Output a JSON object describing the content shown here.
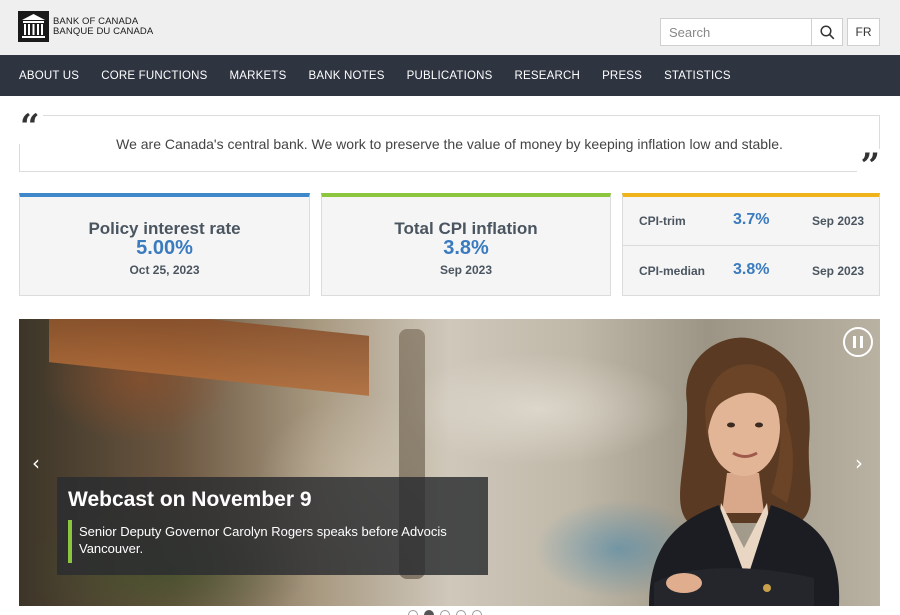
{
  "header": {
    "logo_line1": "BANK OF CANADA",
    "logo_line2": "BANQUE DU CANADA",
    "search_placeholder": "Search",
    "lang_label": "FR"
  },
  "nav": {
    "items": [
      {
        "label": "ABOUT US"
      },
      {
        "label": "CORE FUNCTIONS"
      },
      {
        "label": "MARKETS"
      },
      {
        "label": "BANK NOTES"
      },
      {
        "label": "PUBLICATIONS"
      },
      {
        "label": "RESEARCH"
      },
      {
        "label": "PRESS"
      },
      {
        "label": "STATISTICS"
      }
    ]
  },
  "mission": {
    "text": "We are Canada's central bank. We work to preserve the value of money by keeping inflation low and stable."
  },
  "stats": {
    "policy": {
      "title": "Policy interest rate",
      "value": "5.00%",
      "date": "Oct 25, 2023",
      "accent": "#3e87c8"
    },
    "cpi": {
      "title": "Total CPI inflation",
      "value": "3.8%",
      "date": "Sep 2023",
      "accent": "#8cc63e"
    },
    "core": {
      "accent": "#f0b41a",
      "rows": [
        {
          "label": "CPI-trim",
          "value": "3.7%",
          "date": "Sep 2023"
        },
        {
          "label": "CPI-median",
          "value": "3.8%",
          "date": "Sep 2023"
        }
      ]
    }
  },
  "carousel": {
    "title": "Webcast on November 9",
    "text": "Senior Deputy Governor Carolyn Rogers speaks before Advocis Vancouver.",
    "slide_count": 5,
    "active_slide": 2,
    "icons": {
      "pause": "pause-icon",
      "prev": "chevron-left-icon",
      "next": "chevron-right-icon"
    }
  }
}
